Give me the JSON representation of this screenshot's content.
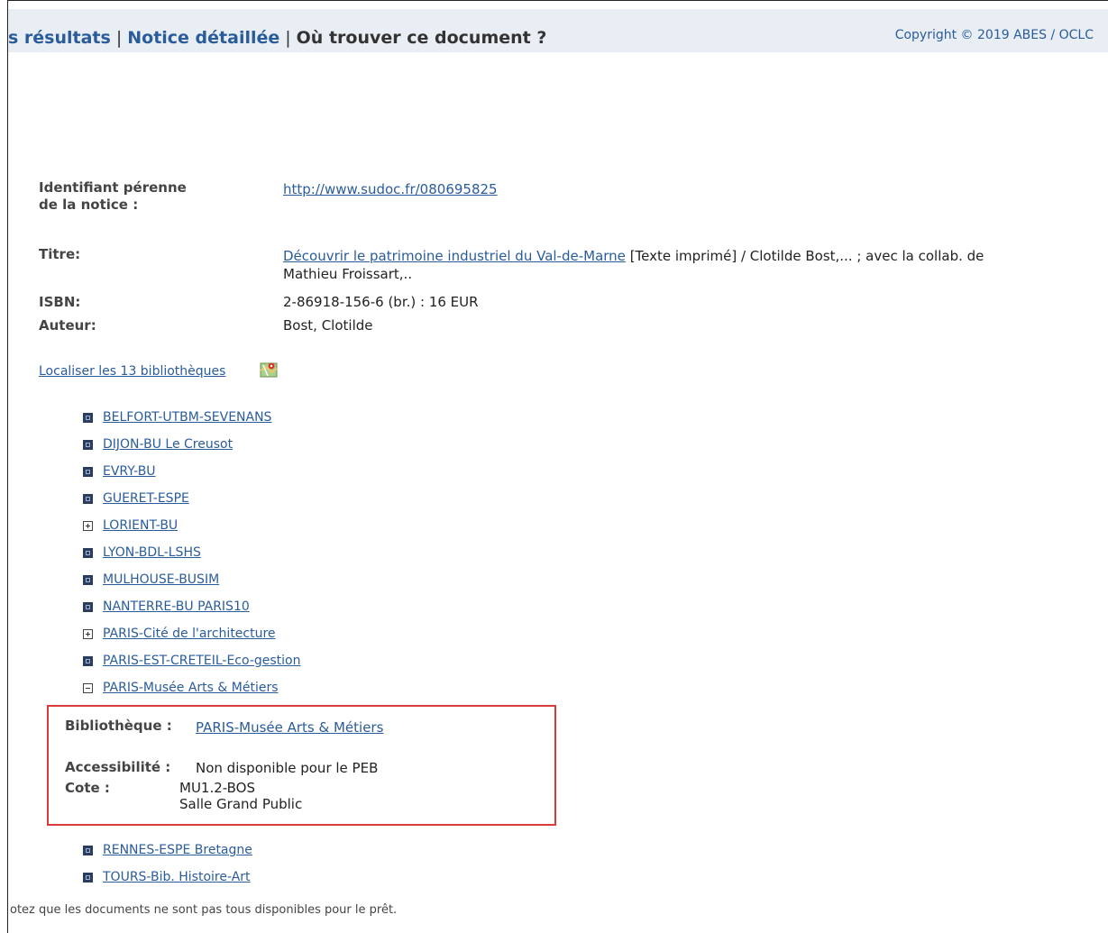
{
  "header": {
    "nav_results": "s résultats",
    "nav_sep": "|",
    "nav_detail": "Notice détaillée",
    "nav_where": "Où trouver ce document ?",
    "copyright": "Copyright © 2019 ABES / OCLC"
  },
  "notice": {
    "identifier_label_1": "Identifiant pérenne",
    "identifier_label_2": "de la notice :",
    "identifier_value": "http://www.sudoc.fr/080695825",
    "title_label": "Titre:",
    "title_link": "Découvrir le patrimoine industriel du Val-de-Marne",
    "title_rest_1": " [Texte imprimé] / Clotilde Bost,... ; avec la collab. de",
    "title_rest_2": "Mathieu Froissart,..",
    "isbn_label": "ISBN:",
    "isbn_value": "2-86918-156-6 (br.) : 16 EUR",
    "author_label": "Auteur:",
    "author_value": "Bost, Clotilde"
  },
  "localiser": {
    "label": "Localiser les 13 bibliothèques",
    "icon": "map-icon"
  },
  "libraries": [
    {
      "name": "BELFORT-UTBM-SEVENANS",
      "state": "filled"
    },
    {
      "name": "DIJON-BU Le Creusot",
      "state": "filled"
    },
    {
      "name": "EVRY-BU",
      "state": "filled"
    },
    {
      "name": "GUERET-ESPE",
      "state": "filled"
    },
    {
      "name": "LORIENT-BU",
      "state": "plus"
    },
    {
      "name": "LYON-BDL-LSHS",
      "state": "filled"
    },
    {
      "name": "MULHOUSE-BUSIM",
      "state": "filled"
    },
    {
      "name": "NANTERRE-BU PARIS10",
      "state": "filled"
    },
    {
      "name": "PARIS-Cité de l'architecture",
      "state": "plus"
    },
    {
      "name": "PARIS-EST-CRETEIL-Eco-gestion",
      "state": "filled"
    },
    {
      "name": "PARIS-Musée Arts & Métiers",
      "state": "minus"
    }
  ],
  "libraries_after": [
    {
      "name": "RENNES-ESPE Bretagne",
      "state": "filled"
    },
    {
      "name": "TOURS-Bib. Histoire-Art",
      "state": "filled"
    }
  ],
  "detail": {
    "library_label": "Bibliothèque :",
    "library_value": "PARIS-Musée Arts & Métiers",
    "access_label": "Accessibilité :",
    "access_value": "Non disponible pour le PEB",
    "cote_label": "Cote :",
    "cote_value_1": "MU1.2-BOS",
    "cote_value_2": "Salle Grand Public"
  },
  "footer": {
    "note": "otez que les documents ne sont pas tous disponibles pour le prêt."
  },
  "colors": {
    "link": "#2a5c9c",
    "highlight_border": "#d93a3a",
    "header_bg": "#e9eef4"
  }
}
